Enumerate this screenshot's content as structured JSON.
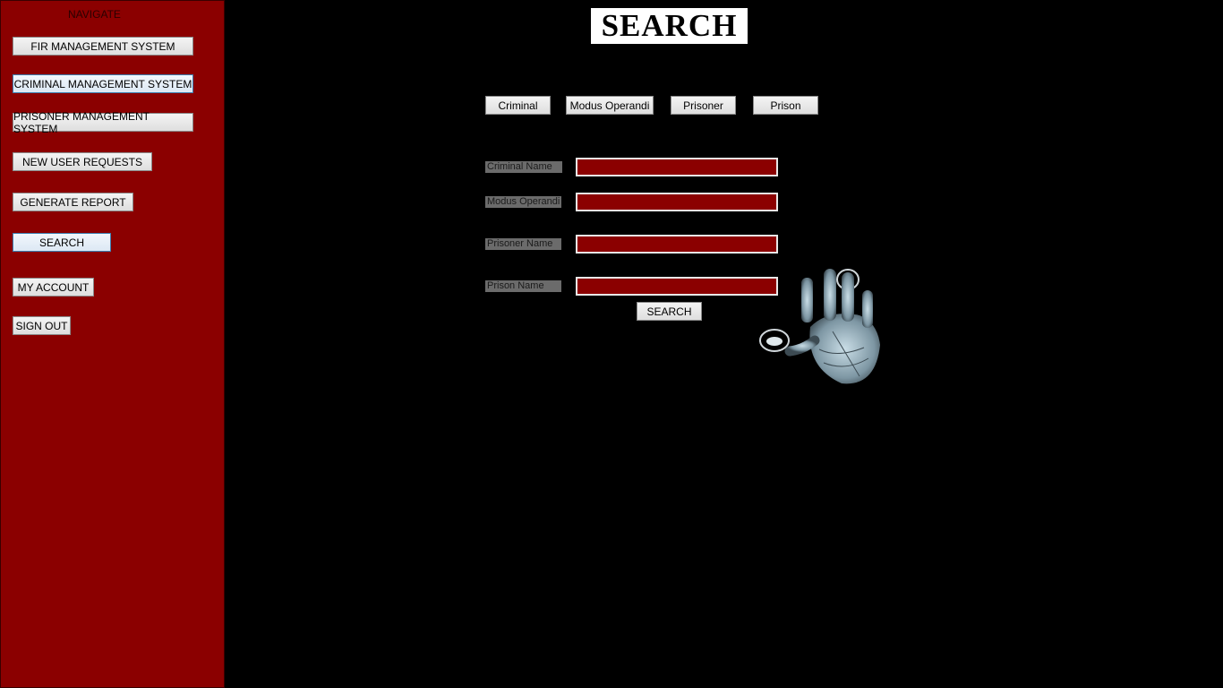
{
  "sidebar": {
    "heading": "NAVIGATE",
    "buttons": {
      "fir": "FIR MANAGEMENT SYSTEM",
      "criminal": "CRIMINAL MANAGEMENT SYSTEM",
      "prisoner": "PRISONER MANAGEMENT SYSTEM",
      "new_user": "NEW USER REQUESTS",
      "report": "GENERATE REPORT",
      "search": "SEARCH",
      "account": "MY ACCOUNT",
      "signout": "SIGN OUT"
    }
  },
  "main": {
    "title": "SEARCH",
    "tabs": {
      "criminal": "Criminal",
      "modus": "Modus Operandi",
      "prisoner": "Prisoner",
      "prison": "Prison"
    },
    "fields": {
      "criminal_name": {
        "label": "Criminal Name",
        "value": ""
      },
      "modus_operandi": {
        "label": "Modus Operandi",
        "value": ""
      },
      "prisoner_name": {
        "label": "Prisoner Name",
        "value": ""
      },
      "prison_name": {
        "label": "Prison Name",
        "value": ""
      }
    },
    "search_button": "SEARCH"
  },
  "colors": {
    "sidebar": "#8b0000",
    "background": "#000000",
    "field": "#8b0000"
  },
  "icons": {
    "decoration": "handprint-icon"
  }
}
